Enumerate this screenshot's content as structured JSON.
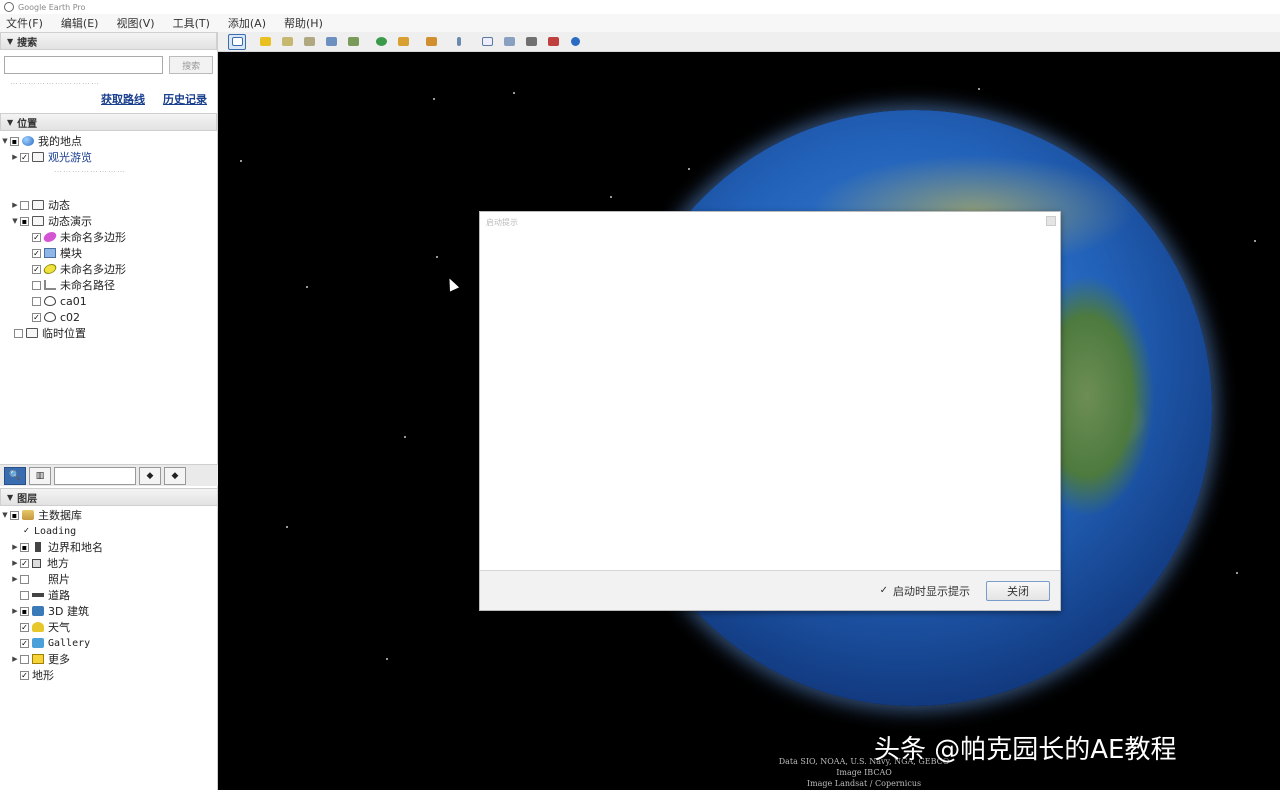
{
  "titlebar": {
    "title": "Google Earth Pro"
  },
  "menu": [
    "文件(F)",
    "编辑(E)",
    "视图(V)",
    "工具(T)",
    "添加(A)",
    "帮助(H)"
  ],
  "search": {
    "header": "搜索",
    "input_value": "",
    "button_label": "搜索",
    "faded_hint": "…………………………",
    "link_directions": "获取路线",
    "link_history": "历史记录"
  },
  "places": {
    "header": "位置",
    "my_places": "我的地点",
    "sightseeing": "观光游览",
    "sightseeing_hint": "……………………",
    "dynamic": "动态",
    "animation_demo": "动态演示",
    "poly1": "未命名多边形",
    "model": "模块",
    "poly2": "未命名多边形",
    "path": "未命名路径",
    "cam1": "ca01",
    "cam2": "c02",
    "temp": "临时位置"
  },
  "layers": {
    "header": "图层",
    "primary_db": "主数据库",
    "loading": "Loading",
    "borders": "边界和地名",
    "places": "地方",
    "photos": "照片",
    "roads": "道路",
    "buildings": "3D 建筑",
    "weather": "天气",
    "gallery": "Gallery",
    "more": "更多",
    "terrain": "地形"
  },
  "dialog": {
    "title": "启动提示",
    "checkbox_label": "启动时显示提示",
    "close_button": "关闭"
  },
  "map": {
    "credits": [
      "Data SIO, NOAA, U.S. Navy, NGA, GEBCO",
      "Image IBCAO",
      "Image Landsat / Copernicus"
    ]
  },
  "watermark": "头条 @帕克园长的AE教程",
  "colors": {
    "link": "#1a3f8f",
    "accent": "#3a6db0"
  }
}
